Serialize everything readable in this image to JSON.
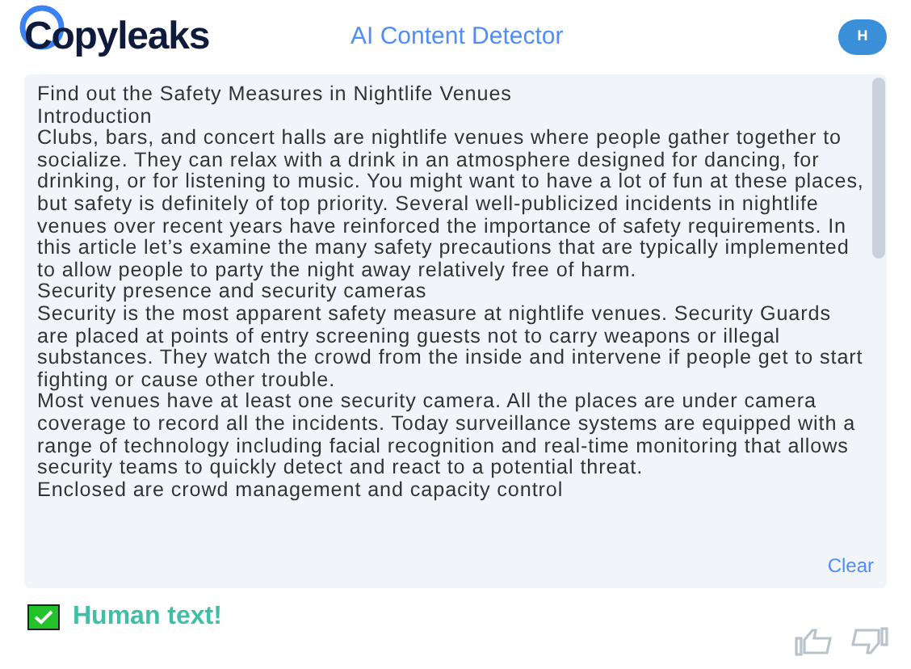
{
  "header": {
    "logo": "Copyleaks",
    "title": "AI Content Detector",
    "avatar": "H"
  },
  "text_input": {
    "paragraphs": [
      "Find out the Safety Measures in Nightlife Venues",
      "Introduction",
      "Clubs, bars, and concert halls are nightlife venues where people gather together to socialize. They can relax with a drink in an atmosphere designed for dancing, for drinking, or for listening to music. You might want to have a lot of fun at these places, but safety is definitely of top priority. Several well-publicized incidents in nightlife venues over recent years have reinforced the importance of safety requirements. In this article let’s examine the many safety precautions that are typically implemented to allow people to party the night away relatively free of harm.",
      "Security presence and security cameras",
      "Security is the most apparent safety measure at nightlife venues. Security Guards are placed at points of entry screening guests not to carry weapons or illegal substances. They watch the crowd from the inside and intervene if people get to start fighting or cause other trouble.",
      "Most venues have at least one security camera. All the places are under camera coverage to record all the incidents. Today surveillance systems are equipped with a range of technology including facial recognition and real-time monitoring that allows security teams to quickly detect and react to a potential threat.",
      "Enclosed are crowd management and capacity control"
    ],
    "clear_button": "Clear"
  },
  "result": {
    "label": "Human text!"
  }
}
